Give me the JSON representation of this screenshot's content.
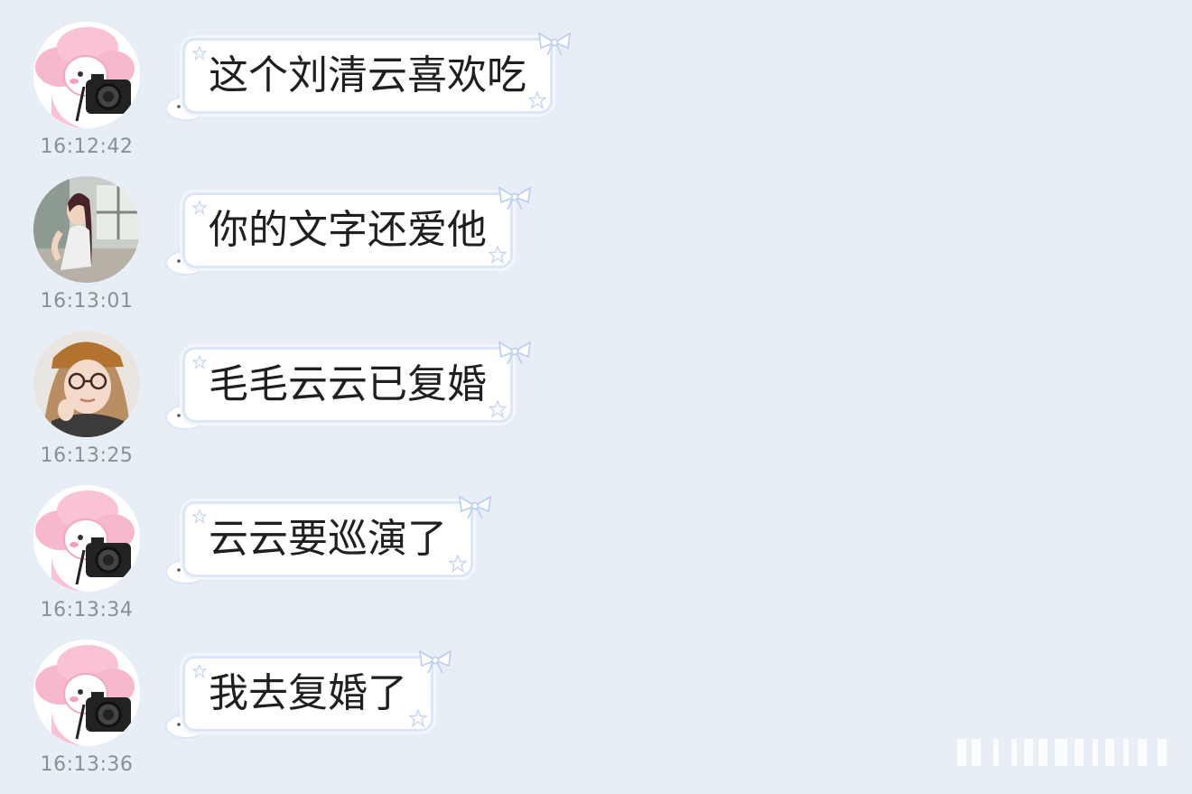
{
  "messages": [
    {
      "avatar": "pink-sheep-with-camera-avatar",
      "text": "这个刘清云喜欢吃",
      "time": "16:12:42"
    },
    {
      "avatar": "woman-photo-avatar",
      "text": "你的文字还爱他",
      "time": "16:13:01"
    },
    {
      "avatar": "woman-with-cap-and-glasses-avatar",
      "text": "毛毛云云已复婚",
      "time": "16:13:25"
    },
    {
      "avatar": "pink-sheep-with-camera-avatar",
      "text": "云云要巡演了",
      "time": "16:13:34"
    },
    {
      "avatar": "pink-sheep-with-camera-avatar",
      "text": "我去复婚了",
      "time": "16:13:36"
    }
  ],
  "colors": {
    "background": "#e8eef6",
    "bubble_border": "#dbe6f8",
    "timestamp": "#8a9099",
    "text": "#1f1f1f"
  }
}
